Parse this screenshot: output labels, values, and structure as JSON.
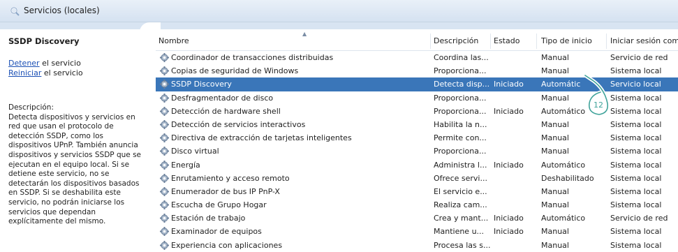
{
  "window": {
    "title": "Servicios (locales)"
  },
  "left_pane": {
    "service_name": "SSDP Discovery",
    "actions": [
      {
        "link": "Detener",
        "suffix": " el servicio"
      },
      {
        "link": "Reiniciar",
        "suffix": " el servicio"
      }
    ],
    "description_label": "Descripción:",
    "description": "Detecta dispositivos y servicios en red que usan el protocolo de detección SSDP, como los dispositivos UPnP. También anuncia dispositivos y servicios SSDP que se ejecutan en el equipo local. Si se detiene este servicio, no se detectarán los dispositivos basados en SSDP. Si se deshabilita este servicio, no podrán iniciarse los servicios que dependan explícitamente del mismo."
  },
  "columns": [
    "Nombre",
    "Descripción",
    "Estado",
    "Tipo de inicio",
    "Iniciar sesión com"
  ],
  "rows": [
    {
      "name": "Coordinador de transacciones distribuidas",
      "desc": "Coordina las...",
      "state": "",
      "start": "Manual",
      "logon": "Servicio de red"
    },
    {
      "name": "Copias de seguridad de Windows",
      "desc": "Proporciona...",
      "state": "",
      "start": "Manual",
      "logon": "Sistema local"
    },
    {
      "name": "SSDP Discovery",
      "desc": "Detecta disp...",
      "state": "Iniciado",
      "start": "Automátic",
      "logon": "Servicio local",
      "selected": true
    },
    {
      "name": "Desfragmentador de disco",
      "desc": "Proporciona...",
      "state": "",
      "start": "Manual",
      "logon": "Sistema local"
    },
    {
      "name": "Detección de hardware shell",
      "desc": "Proporciona...",
      "state": "Iniciado",
      "start": "Automático",
      "logon": "Sistema local"
    },
    {
      "name": "Detección de servicios interactivos",
      "desc": "Habilita la n...",
      "state": "",
      "start": "Manual",
      "logon": "Sistema local"
    },
    {
      "name": "Directiva de extracción de tarjetas inteligentes",
      "desc": "Permite con...",
      "state": "",
      "start": "Manual",
      "logon": "Sistema local"
    },
    {
      "name": "Disco virtual",
      "desc": "Proporciona...",
      "state": "",
      "start": "Manual",
      "logon": "Sistema local"
    },
    {
      "name": "Energía",
      "desc": "Administra l...",
      "state": "Iniciado",
      "start": "Automático",
      "logon": "Sistema local"
    },
    {
      "name": "Enrutamiento y acceso remoto",
      "desc": "Ofrece servi...",
      "state": "",
      "start": "Deshabilitado",
      "logon": "Sistema local"
    },
    {
      "name": "Enumerador de bus IP PnP-X",
      "desc": "El servicio e...",
      "state": "",
      "start": "Manual",
      "logon": "Sistema local"
    },
    {
      "name": "Escucha de Grupo Hogar",
      "desc": "Realiza cam...",
      "state": "",
      "start": "Manual",
      "logon": "Sistema local"
    },
    {
      "name": "Estación de trabajo",
      "desc": "Crea y mant...",
      "state": "Iniciado",
      "start": "Automático",
      "logon": "Servicio de red"
    },
    {
      "name": "Examinador de equipos",
      "desc": "Mantiene u...",
      "state": "Iniciado",
      "start": "Manual",
      "logon": "Sistema local"
    },
    {
      "name": "Experiencia con aplicaciones",
      "desc": "Procesa las s...",
      "state": "",
      "start": "Manual",
      "logon": "Sistema local"
    }
  ],
  "annotation": {
    "label": "12",
    "color": "#3fa39a"
  },
  "colors": {
    "selection": "#3a76b9",
    "link": "#1a4fb5",
    "header_band": "#d8e4f2"
  },
  "icons": {
    "title": "search-icon",
    "service": "gear-icon"
  }
}
